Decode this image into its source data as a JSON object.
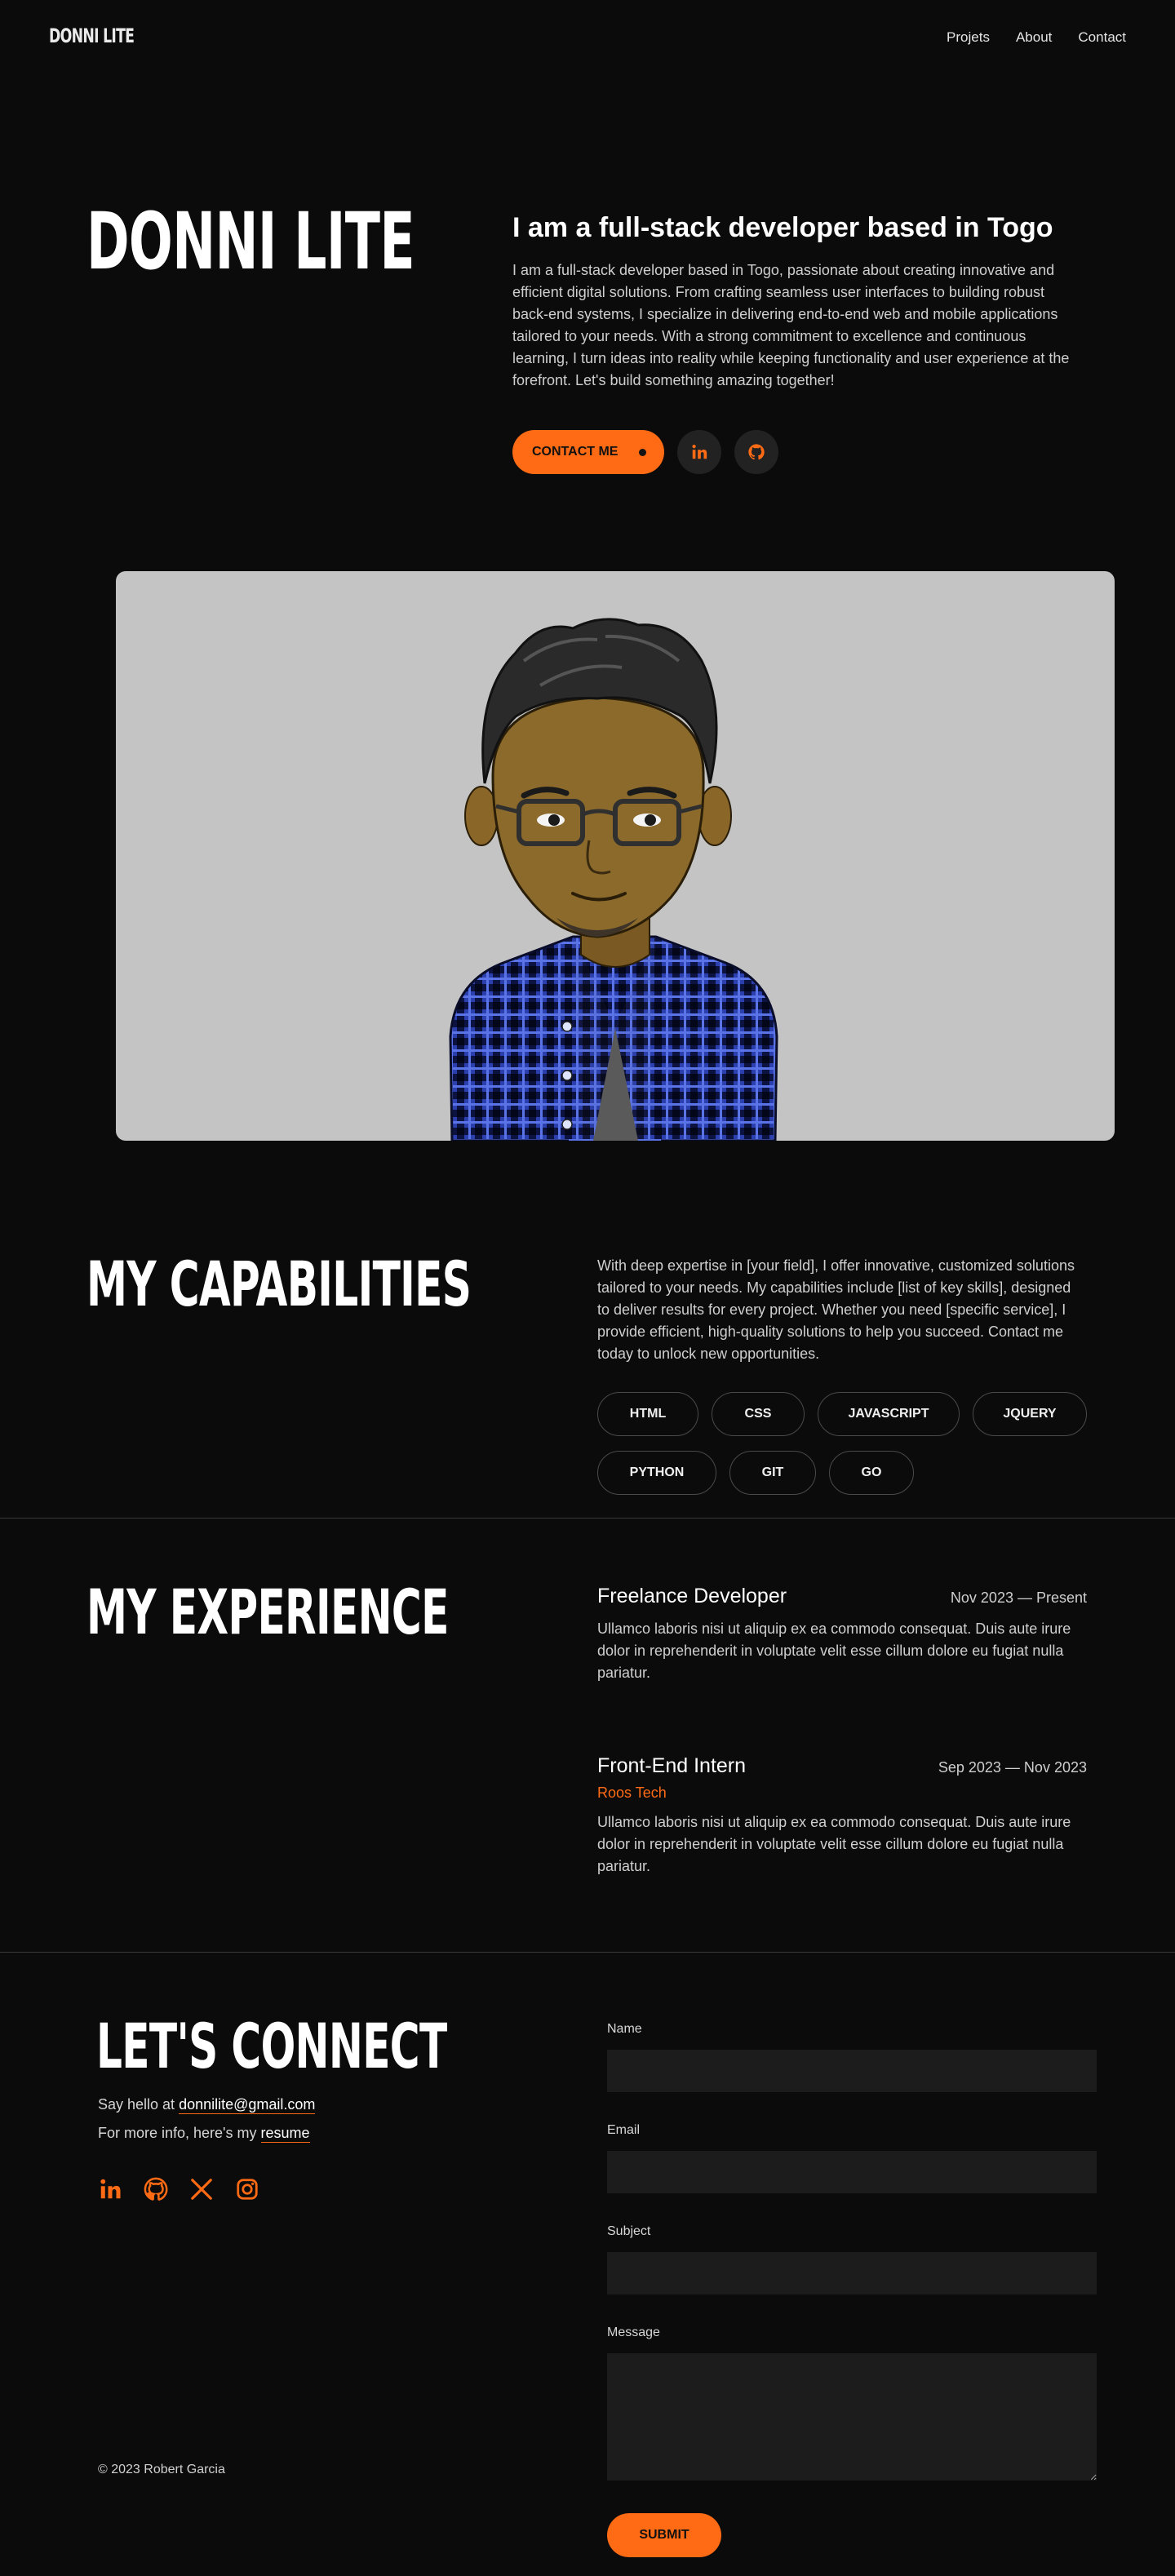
{
  "nav": {
    "logo": "DONNI LITE",
    "links": [
      "Projets",
      "About",
      "Contact"
    ]
  },
  "hero": {
    "name": "DONNI LITE",
    "heading": "I am a full-stack developer based in Togo",
    "description": "I am a full-stack developer based in Togo, passionate about creating innovative and efficient digital solutions. From crafting seamless user interfaces to building robust back-end systems, I specialize in delivering end-to-end web and mobile applications tailored to your needs. With a strong commitment to excellence and continuous learning, I turn ideas into reality while keeping functionality and user experience at the forefront. Let's build something amazing together!",
    "contact_button": "CONTACT ME",
    "social_icons": [
      "linkedin-icon",
      "github-icon"
    ]
  },
  "capabilities": {
    "title": "MY CAPABILITIES",
    "description": "With deep expertise in [your field], I offer innovative, customized solutions tailored to your needs. My capabilities include [list of key skills], designed to deliver results for every project. Whether you need [specific service], I provide efficient, high-quality solutions to help you succeed. Contact me today to unlock new opportunities.",
    "skills": [
      "HTML",
      "CSS",
      "JAVASCRIPT",
      "JQUERY",
      "PYTHON",
      "GIT",
      "GO"
    ]
  },
  "experience": {
    "title": "MY EXPERIENCE",
    "jobs": [
      {
        "title": "Freelance Developer",
        "dates": "Nov 2023 — Present",
        "company": "",
        "description": "Ullamco laboris nisi ut aliquip ex ea commodo consequat. Duis aute irure dolor in reprehenderit in voluptate velit esse cillum dolore eu fugiat nulla pariatur."
      },
      {
        "title": "Front-End Intern",
        "dates": "Sep 2023 — Nov 2023",
        "company": "Roos Tech",
        "description": "Ullamco laboris nisi ut aliquip ex ea commodo consequat. Duis aute irure dolor in reprehenderit in voluptate velit esse cillum dolore eu fugiat nulla pariatur."
      }
    ]
  },
  "connect": {
    "title": "LET'S CONNECT",
    "say_hello_prefix": "Say hello at ",
    "email": "donnilite@gmail.com",
    "resume_prefix": "For more info, here's my ",
    "resume_link": "resume",
    "social_icons": [
      "linkedin-icon",
      "github-icon",
      "x-icon",
      "instagram-icon"
    ],
    "copyright": "© 2023 Robert Garcia"
  },
  "form": {
    "name_label": "Name",
    "email_label": "Email",
    "subject_label": "Subject",
    "message_label": "Message",
    "submit": "SUBMIT"
  },
  "colors": {
    "background": "#0b0b0b",
    "accent": "#ff6b14",
    "field": "#1c1c1c",
    "portrait_bg": "#c4c4c4"
  }
}
